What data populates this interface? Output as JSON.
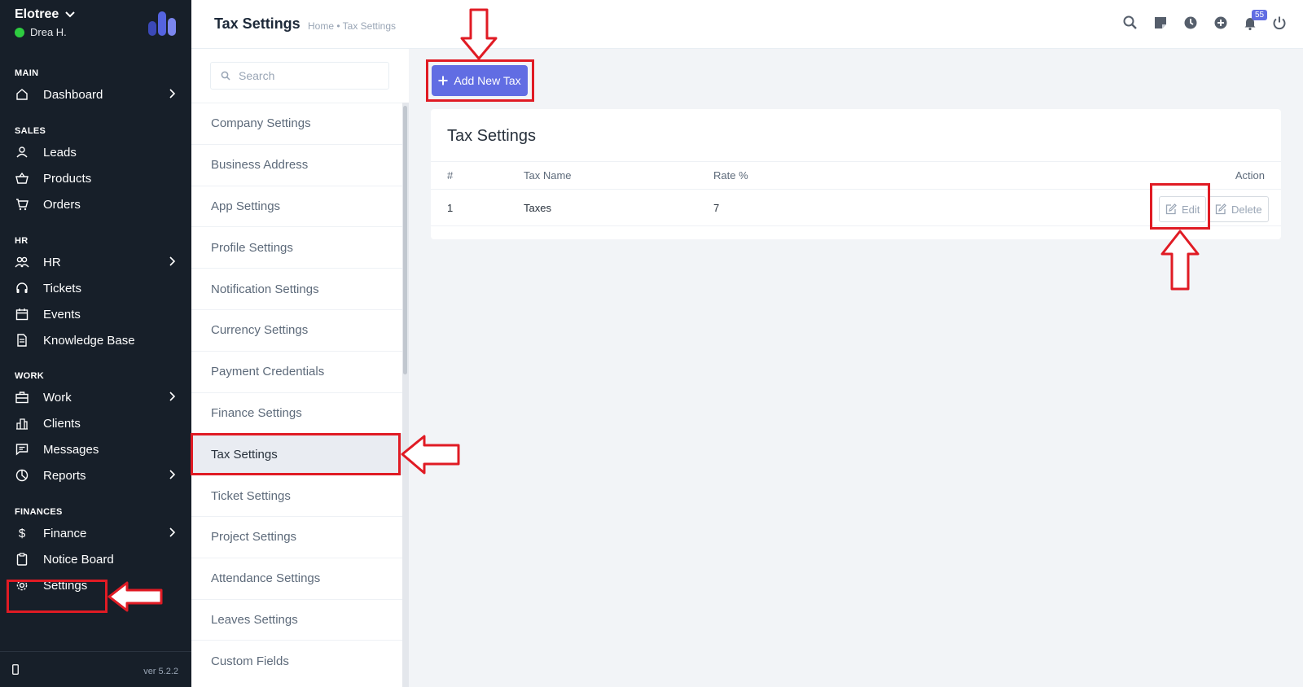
{
  "sidebar": {
    "brand": "Elotree",
    "user": "Drea H.",
    "sections": {
      "main": "MAIN",
      "sales": "SALES",
      "hr": "HR",
      "work": "WORK",
      "finances": "FINANCES"
    },
    "items": {
      "dashboard": "Dashboard",
      "leads": "Leads",
      "products": "Products",
      "orders": "Orders",
      "hr": "HR",
      "tickets": "Tickets",
      "events": "Events",
      "knowledge_base": "Knowledge Base",
      "work": "Work",
      "clients": "Clients",
      "messages": "Messages",
      "reports": "Reports",
      "finance": "Finance",
      "notice_board": "Notice Board",
      "settings": "Settings"
    },
    "version": "ver 5.2.2"
  },
  "header": {
    "title": "Tax Settings",
    "breadcrumb": "Home • Tax Settings",
    "notification_count": "55",
    "icons": [
      "search-icon",
      "sticky-note-icon",
      "clock-icon",
      "plus-circle-icon",
      "bell-icon",
      "power-icon"
    ]
  },
  "settings_menu": {
    "search_placeholder": "Search",
    "items": [
      "Company Settings",
      "Business Address",
      "App Settings",
      "Profile Settings",
      "Notification Settings",
      "Currency Settings",
      "Payment Credentials",
      "Finance Settings",
      "Tax Settings",
      "Ticket Settings",
      "Project Settings",
      "Attendance Settings",
      "Leaves Settings",
      "Custom Fields"
    ],
    "active": "Tax Settings"
  },
  "main": {
    "add_button": "Add New Tax",
    "card_title": "Tax Settings",
    "table": {
      "headers": [
        "#",
        "Tax Name",
        "Rate %",
        "Action"
      ],
      "rows": [
        {
          "num": "1",
          "name": "Taxes",
          "rate": "7",
          "edit": "Edit",
          "delete": "Delete"
        }
      ]
    }
  },
  "colors": {
    "sidebar_bg": "#171f29",
    "accent": "#616de3",
    "annotation_red": "#e01b24",
    "online": "#2ecc40"
  }
}
